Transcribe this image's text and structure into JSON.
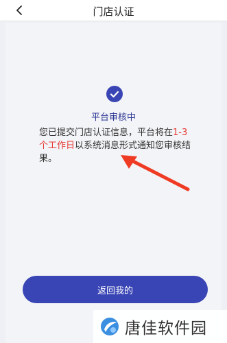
{
  "header": {
    "title": "门店认证",
    "back_icon": "chevron-left-icon"
  },
  "status": {
    "icon": "check-circle-icon",
    "title": "平台审核中",
    "message_before": "您已提交门店认证信息，平台将在",
    "message_highlight": "1-3个工作日",
    "message_after": "以系统消息形式通知您审核结果。"
  },
  "actions": {
    "back_label": "返回我的"
  },
  "watermark": {
    "text": "唐佳软件园"
  },
  "colors": {
    "primary": "#3a45b5",
    "highlight": "#e53935",
    "arrow": "#ef3b24",
    "background": "#eef0f5"
  }
}
